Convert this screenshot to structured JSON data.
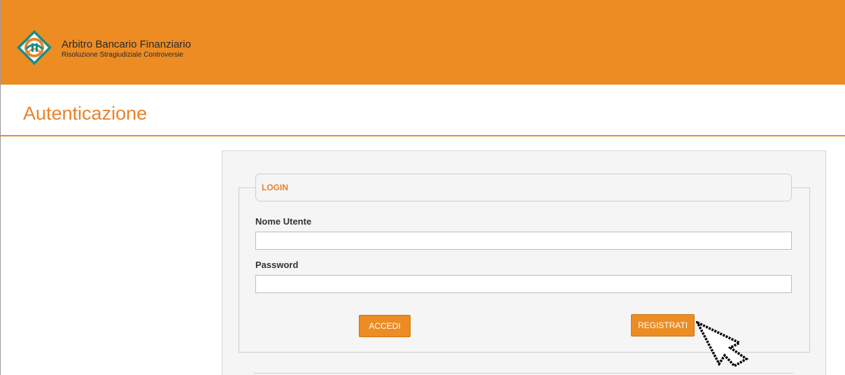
{
  "header": {
    "brand_title": "Arbitro Bancario Finanziario",
    "brand_subtitle": "Risoluzione Stragiudiziale Controversie",
    "background_color": "#ec8c23",
    "logo_icon": "abf-logo-icon"
  },
  "page": {
    "title": "Autenticazione",
    "accent_color": "#e8832a"
  },
  "login": {
    "legend": "LOGIN",
    "username_label": "Nome Utente",
    "username_value": "",
    "password_label": "Password",
    "password_value": "",
    "accedi_label": "ACCEDI",
    "registrati_label": "REGISTRATI"
  },
  "cursor": {
    "icon": "mouse-pointer-icon"
  }
}
